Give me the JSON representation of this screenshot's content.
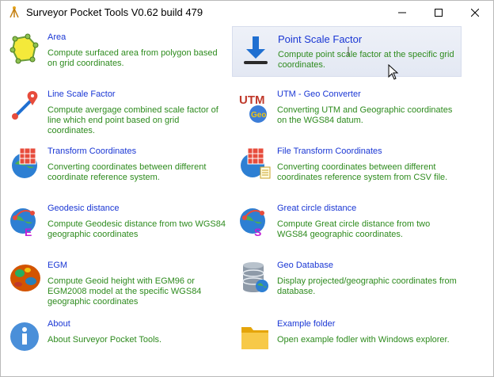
{
  "window": {
    "title": "Surveyor Pocket Tools V0.62 build 479"
  },
  "items": [
    {
      "title": "Area",
      "desc": "Compute surfaced area from polygon based on grid coordinates.",
      "icon": "polygon-area-icon"
    },
    {
      "title": "Point Scale Factor",
      "desc": "Compute point scale factor at the specific grid coordinates.",
      "icon": "down-arrow-icon"
    },
    {
      "title": "Line Scale Factor",
      "desc": "Compute avergage combined scale factor of line which end point based on grid coordinates.",
      "icon": "line-pin-icon"
    },
    {
      "title": "UTM - Geo Converter",
      "desc": "Converting UTM and Geographic coordinates on the WGS84 datum.",
      "icon": "utm-geo-icon"
    },
    {
      "title": "Transform Coordinates",
      "desc": "Converting coordinates between different coordinate reference system.",
      "icon": "globe-grid-icon"
    },
    {
      "title": "File Transform Coordinates",
      "desc": "Converting coordinates between different coordinates reference system from CSV file.",
      "icon": "file-globe-icon"
    },
    {
      "title": "Geodesic distance",
      "desc": "Compute Geodesic distance from two WGS84 geographic coordinates",
      "icon": "globe-e-icon"
    },
    {
      "title": "Great circle distance",
      "desc": "Compute Great circle distance from two WGS84 geographic coordinates.",
      "icon": "globe-s-icon"
    },
    {
      "title": "EGM",
      "desc": "Compute Geoid height with EGM96 or EGM2008 model at the specific WGS84 geographic coordinates",
      "icon": "geoid-icon"
    },
    {
      "title": "Geo Database",
      "desc": "Display projected/geographic coordinates from database.",
      "icon": "database-globe-icon"
    },
    {
      "title": "About",
      "desc": "About Surveyor Pocket Tools.",
      "icon": "info-icon"
    },
    {
      "title": "Example folder",
      "desc": "Open example fodler with Windows explorer.",
      "icon": "folder-icon"
    }
  ],
  "colors": {
    "title_link": "#1a37d4",
    "description": "#2e8b1e",
    "hover_background": "#e8ecf6"
  },
  "hovered_item": "Point Scale Factor"
}
